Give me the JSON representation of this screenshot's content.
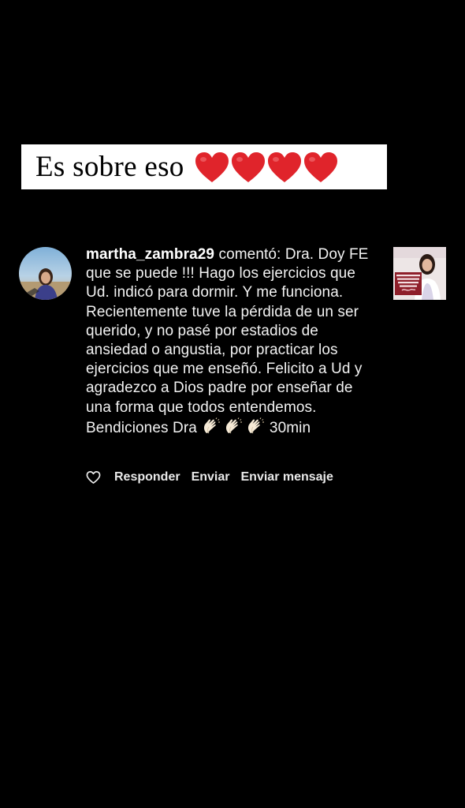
{
  "caption": {
    "text": "Es sobre eso",
    "emoji": "red-heart",
    "emoji_count": 4,
    "emoji_color": "#e0242b"
  },
  "comment": {
    "username": "martha_zambra29",
    "verb": "comentó:",
    "body": "Dra. Doy FE que se puede !!! Hago los ejercicios que Ud. indicó  para dormir. Y me funciona. Recientemente tuve la pérdida de un ser querido, y no pasé por estadios de ansiedad o angustia, por practicar los ejercicios que me enseñó. Felicito a Ud y agradezco a Dios padre por enseñar de una forma que todos entendemos. Bendiciones Dra",
    "emojis": [
      "clapping-hands",
      "clapping-hands",
      "clapping-hands"
    ],
    "time": "30min"
  },
  "thumbnail": {
    "text": "Recupera la energía diaria al hacer tu tratamiento de Sueño"
  },
  "actions": {
    "like_icon": "heart-outline-icon",
    "reply": "Responder",
    "send": "Enviar",
    "message": "Enviar mensaje"
  }
}
